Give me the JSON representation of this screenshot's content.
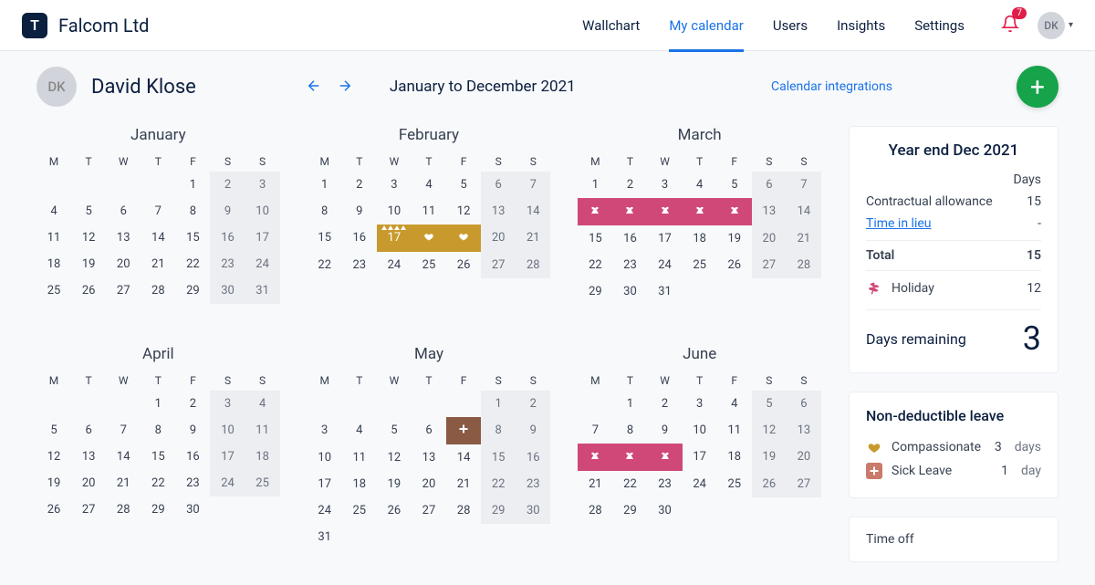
{
  "brand": {
    "logo_letter": "T",
    "name": "Falcom Ltd"
  },
  "nav": {
    "items": [
      "Wallchart",
      "My calendar",
      "Users",
      "Insights",
      "Settings"
    ],
    "active_index": 1,
    "notifications": "7",
    "avatar_initials": "DK"
  },
  "header": {
    "user_initials": "DK",
    "user_name": "David Klose",
    "range": "January to December 2021",
    "integrations": "Calendar integrations"
  },
  "dow": [
    "M",
    "T",
    "W",
    "T",
    "F",
    "S",
    "S"
  ],
  "months": [
    {
      "name": "January",
      "lead": 4,
      "days": 31,
      "marks": {}
    },
    {
      "name": "February",
      "lead": 0,
      "days": 28,
      "marks": {
        "17": "comp-tri",
        "18": "comp",
        "19": "comp"
      }
    },
    {
      "name": "March",
      "lead": 0,
      "days": 31,
      "marks": {
        "8": "hol",
        "9": "hol",
        "10": "hol",
        "11": "hol",
        "12": "hol"
      }
    },
    {
      "name": "April",
      "lead": 3,
      "days": 30,
      "marks": {}
    },
    {
      "name": "May",
      "lead": 5,
      "days": 31,
      "marks": {
        "7": "sick"
      }
    },
    {
      "name": "June",
      "lead": 1,
      "days": 30,
      "marks": {
        "14": "hol",
        "15": "hol",
        "16": "hol"
      }
    }
  ],
  "summary": {
    "title": "Year end Dec 2021",
    "col_label": "Days",
    "rows": {
      "contractual_label": "Contractual allowance",
      "contractual_val": "15",
      "til_label": "Time in lieu",
      "til_val": "-",
      "total_label": "Total",
      "total_val": "15",
      "holiday_label": "Holiday",
      "holiday_val": "12",
      "remaining_label": "Days remaining",
      "remaining_val": "3"
    }
  },
  "nondeduct": {
    "title": "Non-deductible leave",
    "rows": [
      {
        "icon": "comp",
        "label": "Compassionate",
        "val": "3",
        "unit": "days"
      },
      {
        "icon": "sick",
        "label": "Sick Leave",
        "val": "1",
        "unit": "day"
      }
    ]
  },
  "timeoff_label": "Time off"
}
